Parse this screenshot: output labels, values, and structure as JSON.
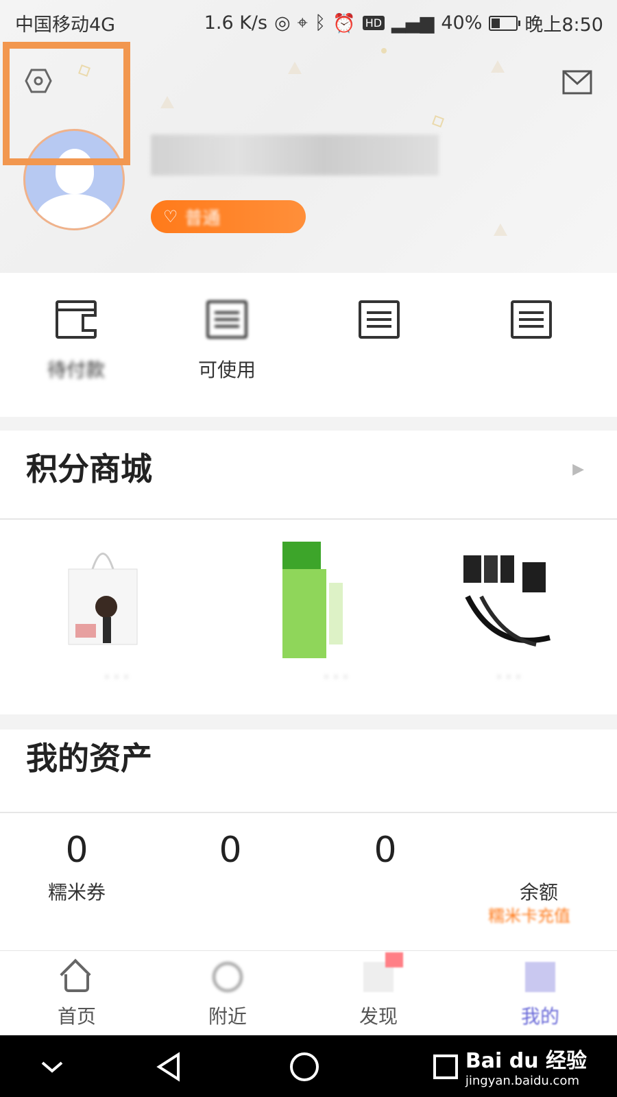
{
  "status_bar": {
    "carrier": "中国移动4G",
    "speed": "1.6 K/s",
    "battery": "40%",
    "time": "晚上8:50"
  },
  "profile": {
    "member_badge": "普通"
  },
  "quick_actions": [
    {
      "label": "待付款",
      "icon": "wallet-icon"
    },
    {
      "label": "可使用",
      "icon": "ticket-icon"
    },
    {
      "label": "",
      "icon": "card-stack-icon"
    },
    {
      "label": "",
      "icon": "receipt-icon"
    }
  ],
  "points_mall": {
    "title": "积分商城"
  },
  "assets": {
    "title": "我的资产",
    "items": [
      {
        "value": "0",
        "label": "糯米券"
      },
      {
        "value": "0",
        "label": ""
      },
      {
        "value": "0",
        "label": ""
      },
      {
        "value": "",
        "label": "余额"
      }
    ],
    "promo": "糯米卡充值"
  },
  "tabbar": [
    {
      "label": "首页"
    },
    {
      "label": "附近"
    },
    {
      "label": "发现"
    },
    {
      "label": "我的"
    }
  ],
  "watermark": {
    "logo": "Bai du 经验",
    "url": "jingyan.baidu.com"
  }
}
